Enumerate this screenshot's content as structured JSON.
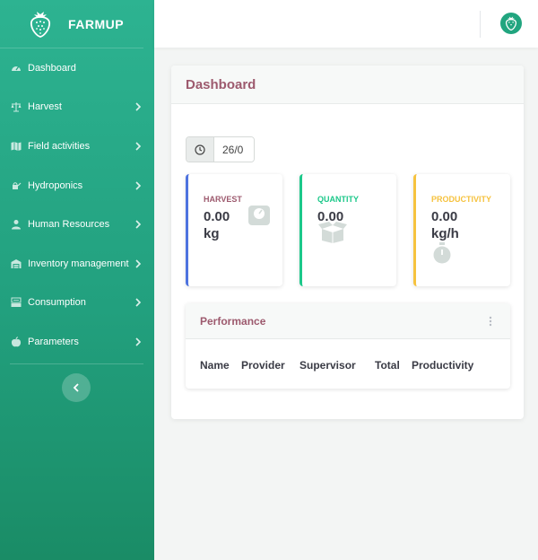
{
  "brand": {
    "name": "FARMUP"
  },
  "sidebar": {
    "items": [
      {
        "label": "Dashboard",
        "icon": "gauge-icon",
        "has_children": false
      },
      {
        "label": "Harvest",
        "icon": "balance-scale-icon",
        "has_children": true
      },
      {
        "label": "Field activities",
        "icon": "map-icon",
        "has_children": true
      },
      {
        "label": "Hydroponics",
        "icon": "watering-can-icon",
        "has_children": true
      },
      {
        "label": "Human Resources",
        "icon": "user-icon",
        "has_children": true
      },
      {
        "label": "Inventory management",
        "icon": "warehouse-icon",
        "has_children": true
      },
      {
        "label": "Consumption",
        "icon": "cash-register-icon",
        "has_children": true
      },
      {
        "label": "Parameters",
        "icon": "apple-icon",
        "has_children": true
      }
    ]
  },
  "main": {
    "title": "Dashboard",
    "date_value": "26/0",
    "stats": {
      "harvest": {
        "label": "HARVEST",
        "value": "0.00",
        "unit": "kg",
        "accent": "#4e73df",
        "icon": "weight-scale-icon"
      },
      "quantity": {
        "label": "QUANTITY",
        "value": "0.00",
        "unit": "",
        "accent": "#1cc88a",
        "icon": "open-box-icon"
      },
      "productivity": {
        "label": "PRODUCTIVITY",
        "value": "0.00",
        "unit": "kg/h",
        "accent": "#f6c23e",
        "icon": "stopwatch-icon"
      }
    },
    "performance": {
      "title": "Performance",
      "columns": [
        "Name",
        "Provider",
        "Supervisor",
        "Total",
        "Productivity"
      ]
    }
  },
  "colors": {
    "sidebar_top": "#2db391",
    "sidebar_bottom": "#1a8c66",
    "title": "#9d5a6e"
  }
}
